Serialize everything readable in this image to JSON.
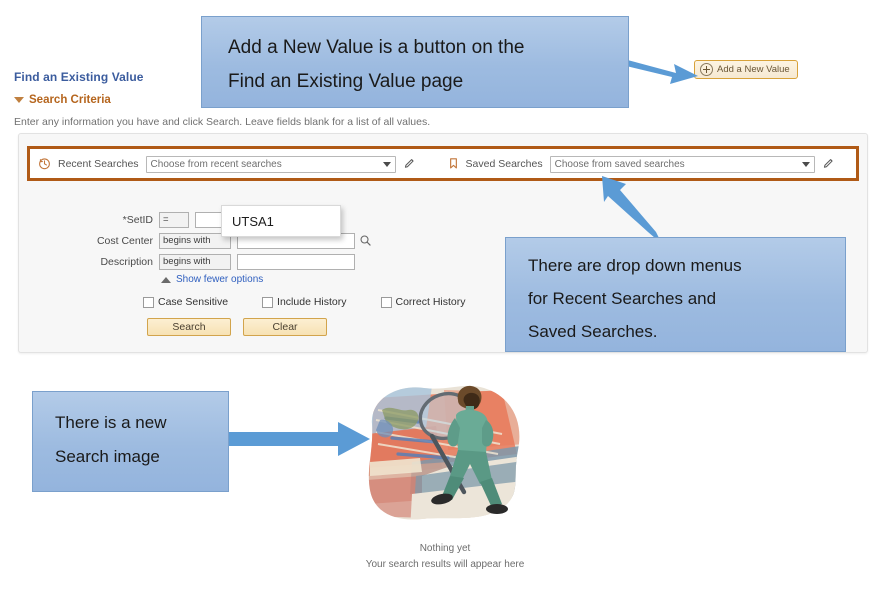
{
  "page": {
    "title": "Find an Existing Value",
    "section_header": "Search Criteria",
    "hint": "Enter any information you have and click Search. Leave fields blank for a list of all values.",
    "add_new_value_label": "Add a New Value"
  },
  "searches": {
    "recent_label": "Recent Searches",
    "recent_placeholder": "Choose from recent searches",
    "recent_value": "Choose from recent searches",
    "saved_label": "Saved Searches",
    "saved_placeholder": "Choose from saved searches",
    "saved_value": "Choose from saved searches",
    "edit_icon": "pencil-icon",
    "recent_icon": "clock-history-icon",
    "saved_icon": "bookmark-icon",
    "highlight_color": "#b05a16"
  },
  "criteria": {
    "rows": [
      {
        "label": "*SetID",
        "operator": "=",
        "value": "",
        "has_lookup": true
      },
      {
        "label": "Cost Center",
        "operator": "begins with",
        "value": "",
        "has_lookup": true
      },
      {
        "label": "Description",
        "operator": "begins with",
        "value": "",
        "has_lookup": false
      }
    ],
    "show_fewer_options": "Show fewer options",
    "checkboxes": [
      {
        "label": "Case Sensitive",
        "checked": false
      },
      {
        "label": "Include History",
        "checked": false
      },
      {
        "label": "Correct History",
        "checked": false
      }
    ],
    "buttons": [
      {
        "label": "Search"
      },
      {
        "label": "Clear"
      }
    ],
    "zoom_callout_value": "UTSA1"
  },
  "results": {
    "empty_title": "Nothing yet",
    "empty_subtitle": "Your search results will appear here",
    "illustration": "person-with-magnifying-glass-search-image"
  },
  "annotations": [
    {
      "id": "add-new-value",
      "line1": "Add a New Value is a button on the",
      "line2": "Find an Existing Value page"
    },
    {
      "id": "dropdowns",
      "line1": "There are drop down menus",
      "line2": "for Recent Searches and",
      "line3": "Saved Searches."
    },
    {
      "id": "search-image",
      "line1": "There is a new",
      "line2": "Search image"
    }
  ],
  "colors": {
    "callout_fill": "#9dbbe0",
    "callout_border": "#7aa0cc",
    "arrow": "#5b9bd5",
    "link_blue": "#3b5c9e",
    "section_orange": "#b5651d"
  }
}
